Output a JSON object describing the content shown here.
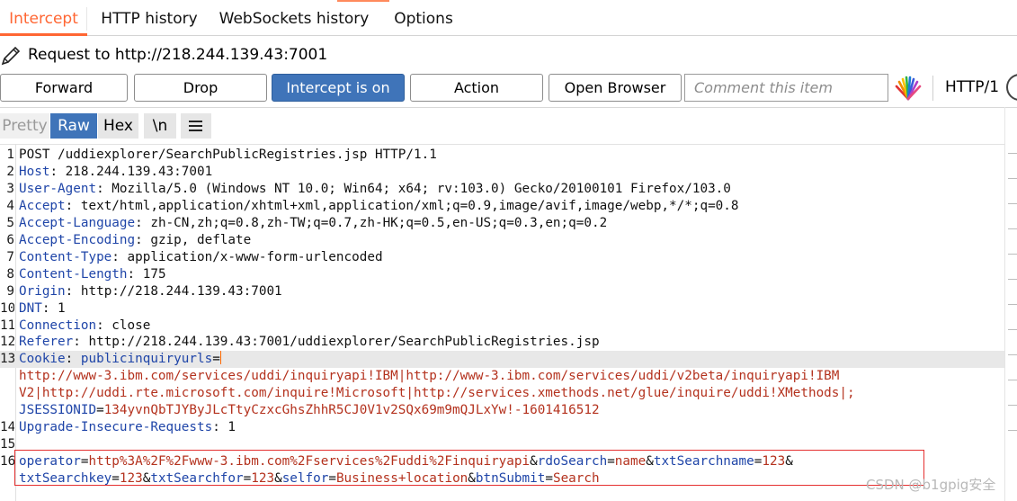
{
  "tabs": [
    {
      "label": "Intercept"
    },
    {
      "label": "HTTP history"
    },
    {
      "label": "WebSockets history"
    },
    {
      "label": "Options"
    }
  ],
  "request_to": "Request to http://218.244.139.43:7001",
  "toolbar": {
    "forward": "Forward",
    "drop": "Drop",
    "intercept": "Intercept is on",
    "action": "Action",
    "open_browser": "Open Browser",
    "comment_placeholder": "Comment this item",
    "http_version": "HTTP/1"
  },
  "view_tabs": {
    "pretty": "Pretty",
    "raw": "Raw",
    "hex": "Hex",
    "newline": "\\n"
  },
  "colors": {
    "accent": "#ff6633",
    "selected": "#3f74b9",
    "header_name": "#1f45a8",
    "value_red": "#b4321e",
    "box_red": "#e53030"
  },
  "request": {
    "lines": [
      {
        "n": "1",
        "text": "POST /uddiexplorer/SearchPublicRegistries.jsp HTTP/1.1"
      },
      {
        "n": "2",
        "name": "Host",
        "value": " 218.244.139.43:7001"
      },
      {
        "n": "3",
        "name": "User-Agent",
        "value": " Mozilla/5.0 (Windows NT 10.0; Win64; x64; rv:103.0) Gecko/20100101 Firefox/103.0"
      },
      {
        "n": "4",
        "name": "Accept",
        "value": " text/html,application/xhtml+xml,application/xml;q=0.9,image/avif,image/webp,*/*;q=0.8"
      },
      {
        "n": "5",
        "name": "Accept-Language",
        "value": " zh-CN,zh;q=0.8,zh-TW;q=0.7,zh-HK;q=0.5,en-US;q=0.3,en;q=0.2"
      },
      {
        "n": "6",
        "name": "Accept-Encoding",
        "value": " gzip, deflate"
      },
      {
        "n": "7",
        "name": "Content-Type",
        "value": " application/x-www-form-urlencoded"
      },
      {
        "n": "8",
        "name": "Content-Length",
        "value": " 175"
      },
      {
        "n": "9",
        "name": "Origin",
        "value": " http://218.244.139.43:7001"
      },
      {
        "n": "10",
        "name": "DNT",
        "value": " 1"
      },
      {
        "n": "11",
        "name": "Connection",
        "value": " close"
      },
      {
        "n": "12",
        "name": "Referer",
        "value": " http://218.244.139.43:7001/uddiexplorer/SearchPublicRegistries.jsp"
      },
      {
        "n": "13",
        "name": "Cookie",
        "cookie_name": "publicinquiryurls"
      },
      {
        "n": "",
        "cookie_value": "http://www-3.ibm.com/services/uddi/inquiryapi!IBM|http://www-3.ibm.com/services/uddi/v2beta/inquiryapi!IBM"
      },
      {
        "n": "",
        "cookie_value": "V2|http://uddi.rte.microsoft.com/inquire!Microsoft|http://services.xmethods.net/glue/inquire/uddi!XMethods|;"
      },
      {
        "n": "",
        "cookie_name": "JSESSIONID",
        "cookie_value": "134yvnQbTJYByJLcTtyCzxcGhsZhhR5CJ0V1v2SQx69m9mQJLxYw!-1601416512"
      },
      {
        "n": "14",
        "name": "Upgrade-Insecure-Requests",
        "value": " 1"
      },
      {
        "n": "15"
      },
      {
        "n": "16",
        "params": [
          {
            "k": "operator",
            "v": "http%3A%2F%2Fwww-3.ibm.com%2Fservices%2Fuddi%2Finquiryapi",
            "sep": "&"
          },
          {
            "k": "rdoSearch",
            "v": "name",
            "sep": "&"
          },
          {
            "k": "txtSearchname",
            "v": "123",
            "sep": "&"
          }
        ]
      },
      {
        "n": "",
        "params": [
          {
            "k": "txtSearchkey",
            "v": "123",
            "sep": "&"
          },
          {
            "k": "txtSearchfor",
            "v": "123",
            "sep": "&"
          },
          {
            "k": "selfor",
            "v": "Business+location",
            "sep": "&"
          },
          {
            "k": "btnSubmit",
            "v": "Search",
            "sep": ""
          }
        ]
      }
    ]
  },
  "watermark": "CSDN @b1gpig安全"
}
